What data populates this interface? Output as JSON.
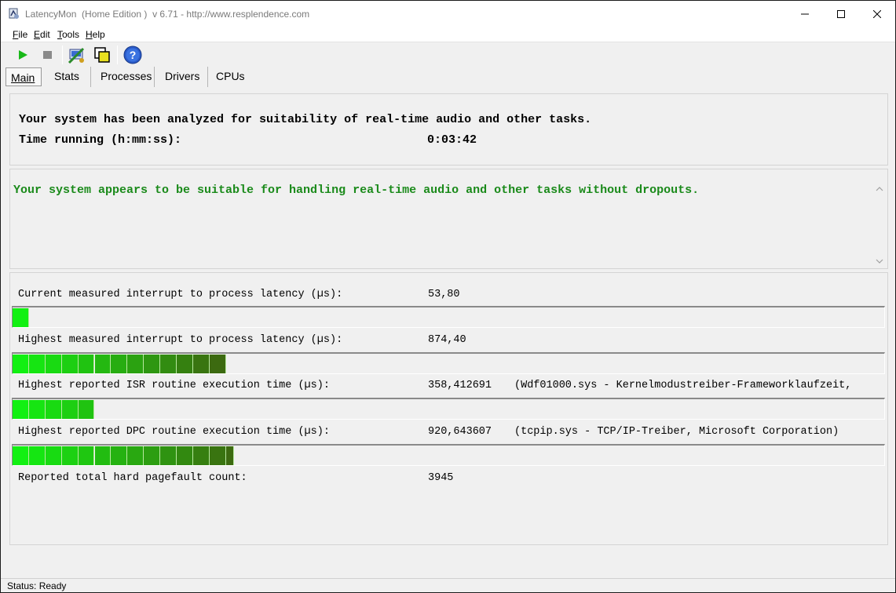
{
  "window": {
    "title": "LatencyMon  (Home Edition )  v 6.71 - http://www.resplendence.com"
  },
  "menu": {
    "file": "File",
    "edit": "Edit",
    "tools": "Tools",
    "help": "Help"
  },
  "toolbar": {
    "icons": [
      "play-icon",
      "stop-icon",
      "options-icon",
      "windows-icon",
      "help-icon"
    ]
  },
  "tabs": [
    "Main",
    "Stats",
    "Processes",
    "Drivers",
    "CPUs"
  ],
  "active_tab": "Main",
  "summary": {
    "analysis_line": "Your system has been analyzed for suitability of real-time audio and other tasks.",
    "time_label": "Time running (h:mm:ss):",
    "time_value": "0:03:42"
  },
  "verdict": {
    "text": "Your system appears to be suitable for handling real-time audio and other tasks without dropouts.",
    "color": "#1a8a1a"
  },
  "metrics": [
    {
      "label": "Current measured interrupt to process latency (µs):",
      "value": "53,80",
      "detail": "",
      "bar_segments": 1
    },
    {
      "label": "Highest measured interrupt to process latency (µs):",
      "value": "874,40",
      "detail": "",
      "bar_segments": 13
    },
    {
      "label": "Highest reported ISR routine execution time (µs):",
      "value": "358,412691",
      "detail": "(Wdf01000.sys - Kernelmodustreiber-Frameworklaufzeit,",
      "bar_segments": 5
    },
    {
      "label": "Highest reported DPC routine execution time (µs):",
      "value": "920,643607",
      "detail": "(tcpip.sys - TCP/IP-Treiber, Microsoft Corporation)",
      "bar_segments": 13.5
    },
    {
      "label": "Reported total hard pagefault count:",
      "value": "3945",
      "detail": ""
    }
  ],
  "colors": {
    "bar_start": "#12f012",
    "bar_end": "#3c6a10"
  },
  "status": {
    "text": "Status: Ready"
  }
}
